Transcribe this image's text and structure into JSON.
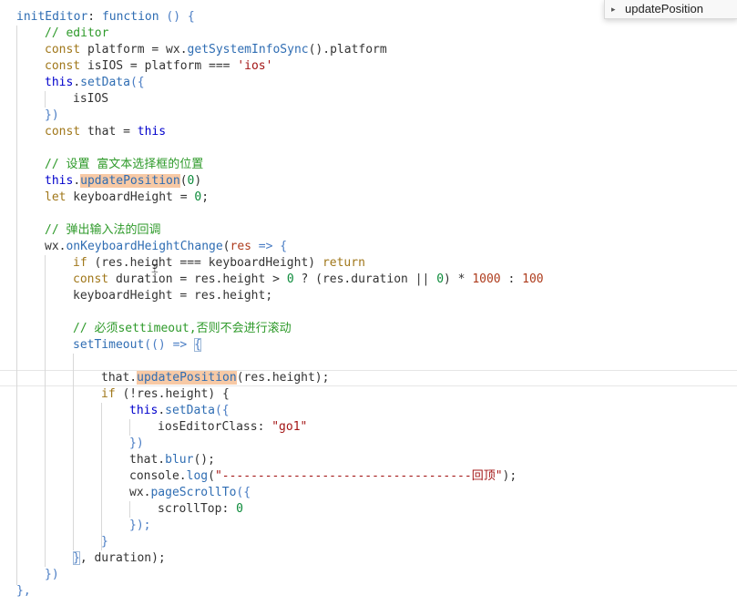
{
  "outline_popup": {
    "item_label": "updatePosition",
    "icon": "chevron-right-icon"
  },
  "code": {
    "l01_a": "initEditor",
    "l01_b": ": ",
    "l01_c": "function",
    "l01_d": " () {",
    "l02": "// editor",
    "l03_a": "const",
    "l03_b": " platform = wx.",
    "l03_c": "getSystemInfoSync",
    "l03_d": "().platform",
    "l04_a": "const",
    "l04_b": " isIOS = platform === ",
    "l04_c": "'ios'",
    "l05_a": "this",
    "l05_b": ".",
    "l05_c": "setData",
    "l05_d": "({",
    "l06": "isIOS",
    "l07": "})",
    "l08_a": "const",
    "l08_b": " that = ",
    "l08_c": "this",
    "l10": "// 设置 富文本选择框的位置",
    "l11_a": "this",
    "l11_b": ".",
    "l11_c": "updatePosition",
    "l11_d": "(",
    "l11_e": "0",
    "l11_f": ")",
    "l12_a": "let",
    "l12_b": " keyboardHeight = ",
    "l12_c": "0",
    "l12_d": ";",
    "l14": "// 弹出输入法的回调",
    "l15_a": "wx.",
    "l15_b": "onKeyboardHeightChange",
    "l15_c": "(",
    "l15_d": "res",
    "l15_e": " => {",
    "l16_a": "if",
    "l16_b": " (res.height === keyboardHeight) ",
    "l16_c": "return",
    "l17_a": "const",
    "l17_b": " duration = res.height > ",
    "l17_c": "0",
    "l17_d": " ? (res.duration || ",
    "l17_e": "0",
    "l17_f": ") * ",
    "l17_g": "1000",
    "l17_h": " : ",
    "l17_i": "100",
    "l18": "keyboardHeight = res.height;",
    "l20": "// 必须settimeout,否则不会进行滚动",
    "l21_a": "setTimeout",
    "l21_b": "(() => ",
    "l21_c": "{",
    "l23_a": "that.",
    "l23_b": "updatePosition",
    "l23_c": "(res.height);",
    "l24_a": "if",
    "l24_b": " (!res.height) {",
    "l25_a": "this",
    "l25_b": ".",
    "l25_c": "setData",
    "l25_d": "({",
    "l26_a": "iosEditorClass: ",
    "l26_b": "\"go1\"",
    "l27": "})",
    "l28_a": "that.",
    "l28_b": "blur",
    "l28_c": "();",
    "l29_a": "console.",
    "l29_b": "log",
    "l29_c": "(",
    "l29_d": "\"-----------------------------------回顶\"",
    "l29_e": ");",
    "l30_a": "wx.",
    "l30_b": "pageScrollTo",
    "l30_c": "({",
    "l31_a": "scrollTop: ",
    "l31_b": "0",
    "l32": "});",
    "l33": "}",
    "l34_a": "}",
    "l34_b": ", duration);",
    "l35": "})",
    "l36": "},"
  }
}
